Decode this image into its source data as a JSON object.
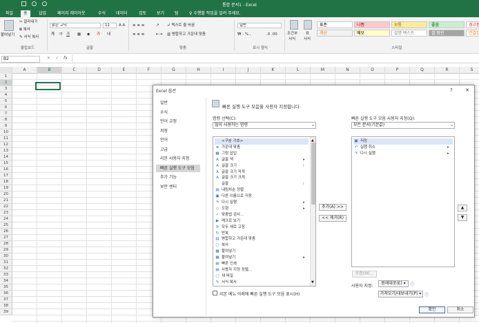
{
  "window": {
    "title": "통합 문서1 - Excel"
  },
  "tabs": [
    "파일",
    "홈",
    "삽입",
    "페이지 레이아웃",
    "수식",
    "데이터",
    "검토",
    "보기",
    "팀"
  ],
  "active_tab": 1,
  "tell_me": "수행할 작업을 알려 주세요.",
  "ribbon": {
    "paste": "붙여넣기",
    "cut": "잘라내기",
    "copy": "복사",
    "format_painter": "서식 복사",
    "font_name": "맑은 고딕",
    "font_size": "11",
    "wrap_text": "텍스트 줄 바꿈",
    "merge_center": "병합하고 가운데 맞춤",
    "number_format": "일반",
    "conditional": "조건부",
    "conditional2": "서식",
    "table_format": "표",
    "table_format2": "서식",
    "styles": [
      {
        "label": "표준",
        "bg": "#ffffff",
        "color": "#000000"
      },
      {
        "label": "나쁨",
        "bg": "#ffc7ce",
        "color": "#9c0006"
      },
      {
        "label": "보통",
        "bg": "#ffeb9c",
        "color": "#9c6500"
      },
      {
        "label": "좋음",
        "bg": "#c6efce",
        "color": "#006100"
      },
      {
        "label": "경고문",
        "bg": "#ffffff",
        "color": "#ff0000"
      },
      {
        "label": "계산",
        "bg": "#f2f2f2",
        "color": "#fa7d00"
      },
      {
        "label": "메모",
        "bg": "#ffffcc",
        "color": "#000000"
      },
      {
        "label": "설명 텍스트",
        "bg": "#ffffff",
        "color": "#7f7f7f"
      },
      {
        "label": "셀 확인",
        "bg": "#a5a5a5",
        "color": "#ffffff"
      },
      {
        "label": "연결된 셀",
        "bg": "#ffffff",
        "color": "#fa7d00"
      }
    ],
    "groups": [
      "클립보드",
      "글꼴",
      "맞춤",
      "표시 형식",
      "스타일"
    ]
  },
  "formula": {
    "namebox": "B2",
    "fx": "fx"
  },
  "columns": [
    "A",
    "B",
    "C",
    "D",
    "E",
    "F",
    "G",
    "H",
    "I",
    "J",
    "K",
    "L",
    "M",
    "N",
    "O",
    "P",
    "Q",
    "R",
    "S"
  ],
  "rows": [
    "1",
    "2",
    "3",
    "4",
    "5",
    "6",
    "7",
    "8",
    "9",
    "10",
    "11",
    "12",
    "13",
    "14",
    "15",
    "16",
    "17",
    "18",
    "19",
    "20",
    "21",
    "22",
    "23",
    "24",
    "25",
    "26",
    "27",
    "28",
    "29",
    "30",
    "31",
    "32",
    "33",
    "34",
    "35",
    "36",
    "37",
    "38",
    "39"
  ],
  "dialog": {
    "title": "Excel 옵션",
    "help": "?",
    "close": "✕",
    "nav": [
      "일반",
      "수식",
      "언어 교정",
      "저장",
      "언어",
      "고급",
      "리본 사용자 지정",
      "빠른 실행 도구 모음",
      "추가 기능",
      "보안 센터"
    ],
    "nav_selected": 7,
    "heading": "빠른 실행 도구 모음을 사용자 지정합니다.",
    "choose_label": "명령 선택(C):",
    "choose_value": "많이 사용하는 명령",
    "customize_label": "빠른 실행 도구 모음 사용자 지정(Q):",
    "customize_value": "모든 문서(기본값)",
    "commands": [
      {
        "icon": "",
        "label": "<구분 기호>",
        "sep": true
      },
      {
        "icon": "≡",
        "label": "가운데 맞춤"
      },
      {
        "icon": "▦",
        "label": "그림 삽입"
      },
      {
        "icon": "A",
        "label": "글꼴 색",
        "sub": true
      },
      {
        "icon": "A",
        "label": "글꼴 크기",
        "sub2": true
      },
      {
        "icon": "A",
        "label": "글꼴 크기 작게"
      },
      {
        "icon": "A",
        "label": "글꼴 크기 크게"
      },
      {
        "icon": "",
        "label": "글꼴",
        "sub2": true
      },
      {
        "icon": "▤",
        "label": "내림차순 정렬"
      },
      {
        "icon": "▣",
        "label": "다른 이름으로 저장"
      },
      {
        "icon": "↷",
        "label": "다시 실행",
        "sub": true
      },
      {
        "icon": "◇",
        "label": "도형",
        "sub": true
      },
      {
        "icon": "✓",
        "label": "맞춤법 검사..."
      },
      {
        "icon": "▶",
        "label": "매크로 보기"
      },
      {
        "icon": "⟳",
        "label": "모두 새로 고침"
      },
      {
        "icon": "↻",
        "label": "반복"
      },
      {
        "icon": "▥",
        "label": "병합하고 가운데 맞춤"
      },
      {
        "icon": "▢",
        "label": "복사"
      },
      {
        "icon": "▦",
        "label": "붙여넣기"
      },
      {
        "icon": "▦",
        "label": "붙여넣기",
        "sub": true
      },
      {
        "icon": "▤",
        "label": "빠른 인쇄"
      },
      {
        "icon": "▤",
        "label": "사용자 지정 정렬..."
      },
      {
        "icon": "▢",
        "label": "새 파일"
      },
      {
        "icon": "✎",
        "label": "서식 복사"
      }
    ],
    "qat": [
      {
        "icon": "▣",
        "label": "저장"
      },
      {
        "icon": "↶",
        "label": "실행 취소",
        "sub": true
      },
      {
        "icon": "↷",
        "label": "다시 실행",
        "sub": true
      }
    ],
    "add_button": "추가(A) >>",
    "remove_button": "<< 제거(R)",
    "modify_button": "수정(M)...",
    "customizations_label": "사용자 지정:",
    "reset_button": "원래대로(E)",
    "import_export_button": "가져오기/내보내기(P)",
    "show_below_label": "리본 메뉴 아래에 빠른 실행 도구 모음 표시(H)",
    "ok_button": "확인",
    "cancel_button": "취소"
  }
}
